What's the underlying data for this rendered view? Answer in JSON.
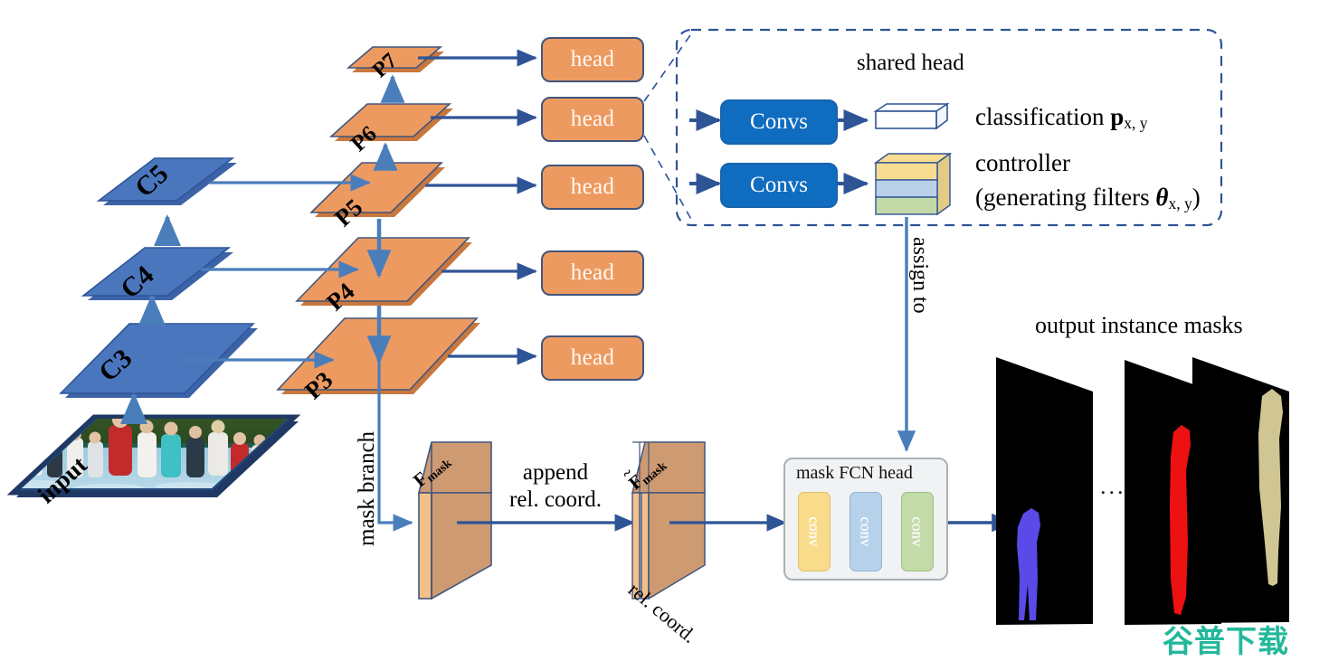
{
  "title": "BlendMask/CondInst-style instance segmentation architecture diagram",
  "backbone": {
    "levels": [
      {
        "id": "C5",
        "label": "C5"
      },
      {
        "id": "C4",
        "label": "C4"
      },
      {
        "id": "C3",
        "label": "C3"
      }
    ],
    "input_label": "input"
  },
  "fpn": {
    "levels": [
      {
        "id": "P7",
        "label": "P7"
      },
      {
        "id": "P6",
        "label": "P6"
      },
      {
        "id": "P5",
        "label": "P5"
      },
      {
        "id": "P4",
        "label": "P4"
      },
      {
        "id": "P3",
        "label": "P3"
      }
    ]
  },
  "heads": [
    {
      "label": "head"
    },
    {
      "label": "head"
    },
    {
      "label": "head"
    },
    {
      "label": "head"
    },
    {
      "label": "head"
    }
  ],
  "shared_head": {
    "title": "shared head",
    "conv_blocks": [
      {
        "label": "Convs"
      },
      {
        "label": "Convs"
      }
    ],
    "outputs": [
      {
        "text_main": "classification ",
        "symbol": "p",
        "subscript": "x, y"
      },
      {
        "text_main": "controller",
        "line2_pre": "(generating filters ",
        "symbol": "θ",
        "subscript": "x, y",
        "line2_post": ")"
      }
    ],
    "controller_layer_colors": [
      "#F7DC91",
      "#B9D0E8",
      "#C3D9A8"
    ],
    "classification_box_color": "#FFFFFF"
  },
  "assign_arrow": {
    "label": "assign to"
  },
  "mask_branch": {
    "label": "mask branch",
    "feature_1": {
      "symbol": "F",
      "subscript": "mask",
      "tilde": false
    },
    "feature_2": {
      "symbol": "F",
      "subscript": "mask",
      "tilde": true
    },
    "append_text_line1": "append",
    "append_text_line2": "rel. coord.",
    "rel_coord_label": "rel. coord."
  },
  "mask_fcn_head": {
    "title": "mask FCN head",
    "convs": [
      {
        "label": "conv",
        "color": "#F8DC8C"
      },
      {
        "label": "conv",
        "color": "#B6D1EA"
      },
      {
        "label": "conv",
        "color": "#C2DBA8"
      }
    ]
  },
  "output": {
    "title": "output instance masks",
    "ellipsis": "...",
    "masks": [
      {
        "color": "#5A4BE8",
        "name": "mask-person-blue"
      },
      {
        "color": "#EE1111",
        "name": "mask-person-red"
      },
      {
        "color": "#CFC694",
        "name": "mask-person-khaki"
      }
    ],
    "canvas_color": "#000000"
  },
  "watermark": {
    "text": "谷普下载",
    "color": "#24B89B"
  },
  "colors": {
    "backbone_plane": "#4A76BE",
    "fpn_plane": "#ED9A61",
    "arrow_blue": "#4A7EBB",
    "arrow_dark": "#2F5496",
    "dashed_border": "#2F5496",
    "feature_face": "#CE9A72",
    "feature_edge": "#F4C08A"
  }
}
